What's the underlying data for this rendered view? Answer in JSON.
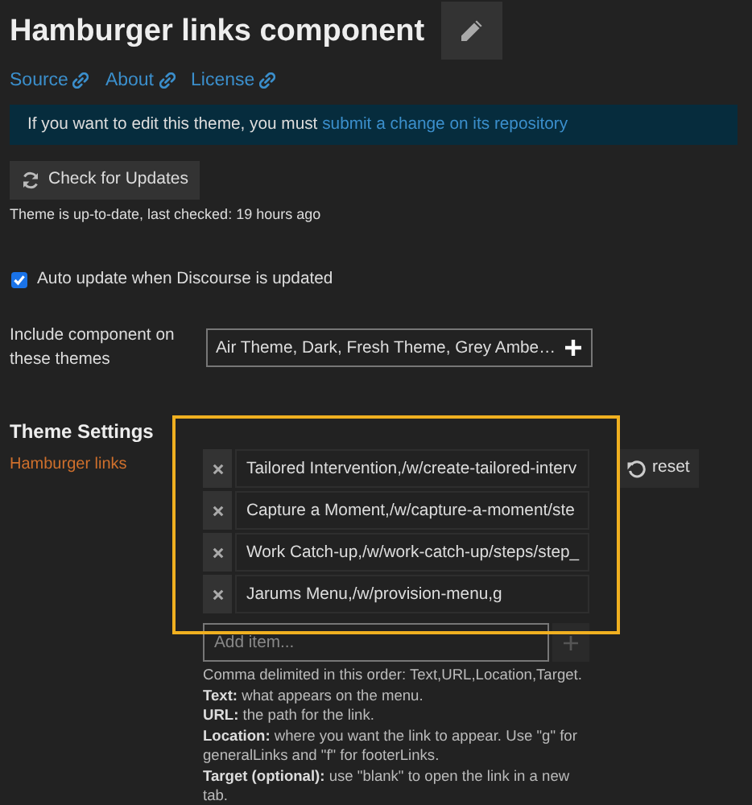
{
  "title": "Hamburger links component",
  "links": [
    "Source",
    "About",
    "License"
  ],
  "banner": {
    "text": "If you want to edit this theme, you must ",
    "link": "submit a change on its repository"
  },
  "check_button": "Check for Updates",
  "status": "Theme is up-to-date, last checked: 19 hours ago",
  "auto_update": {
    "label": "Auto update when Discourse is updated",
    "checked": true
  },
  "include": {
    "label": "Include component on these themes",
    "value": "Air Theme, Dark, Fresh Theme, Grey Ambe…"
  },
  "settings": {
    "heading": "Theme Settings",
    "setting_name": "Hamburger links",
    "items": [
      "Tailored Intervention,/w/create-tailored-interv",
      "Capture a Moment,/w/capture-a-moment/ste",
      "Work Catch-up,/w/work-catch-up/steps/step_",
      "Jarums Menu,/w/provision-menu,g"
    ],
    "reset": "reset",
    "add_placeholder": "Add item...",
    "help": [
      "Comma delimited in this order: Text,URL,Location,Target.",
      "**Text:** what appears on the menu.",
      "**URL:** the path for the link.",
      "**Location:** where you want the link to appear. Use \"g\" for generalLinks and \"f\" for footerLinks.",
      "**Target (optional):** use \"blank\" to open the link in a new tab."
    ]
  }
}
